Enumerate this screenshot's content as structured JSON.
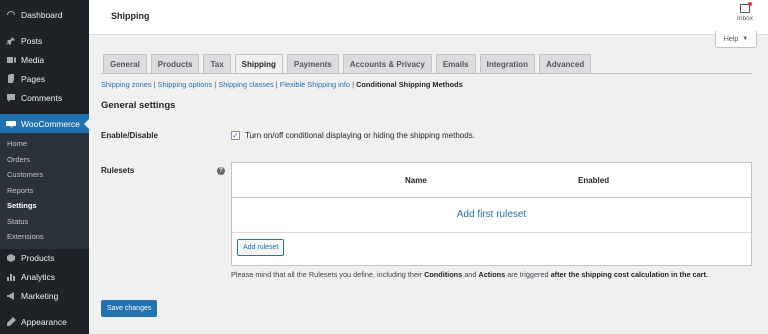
{
  "sidebar": {
    "top_items": [
      {
        "label": "Dashboard",
        "icon": "dashboard-icon"
      },
      {
        "label": "Posts",
        "icon": "pin-icon"
      },
      {
        "label": "Media",
        "icon": "media-icon"
      },
      {
        "label": "Pages",
        "icon": "pages-icon"
      },
      {
        "label": "Comments",
        "icon": "comments-icon"
      }
    ],
    "woocommerce": {
      "label": "WooCommerce",
      "icon": "woocommerce-icon"
    },
    "sub_items": [
      "Home",
      "Orders",
      "Customers",
      "Reports",
      "Settings",
      "Status",
      "Extensions"
    ],
    "current_sub": "Settings",
    "bottom_items": [
      {
        "label": "Products",
        "icon": "products-icon"
      },
      {
        "label": "Analytics",
        "icon": "analytics-icon"
      },
      {
        "label": "Marketing",
        "icon": "marketing-icon"
      },
      {
        "label": "Appearance",
        "icon": "appearance-icon"
      }
    ]
  },
  "header": {
    "title": "Shipping",
    "inbox_label": "Inbox",
    "help_label": "Help"
  },
  "tabs": [
    "General",
    "Products",
    "Tax",
    "Shipping",
    "Payments",
    "Accounts & Privacy",
    "Emails",
    "Integration",
    "Advanced"
  ],
  "active_tab": "Shipping",
  "subsections": {
    "links": [
      "Shipping zones",
      "Shipping options",
      "Shipping classes",
      "Flexible Shipping info"
    ],
    "current": "Conditional Shipping Methods",
    "separator": " | "
  },
  "section_title": "General settings",
  "enable": {
    "label": "Enable/Disable",
    "checkbox_text": "Turn on/off conditional displaying or hiding the shipping methods.",
    "checked": true
  },
  "rulesets": {
    "label": "Rulesets",
    "tip_icon": "question-icon",
    "columns": [
      "Name",
      "Enabled"
    ],
    "empty_link": "Add first ruleset",
    "add_button": "Add ruleset"
  },
  "note": {
    "prefix": "Please mind that all the Rulesets you define, including their ",
    "conditions": "Conditions",
    "and": " and ",
    "actions": "Actions",
    "middle": " are triggered ",
    "emph": "after the shipping cost calculation in the cart."
  },
  "save_button": "Save changes",
  "colors": {
    "accent": "#2271b1",
    "sidebar_bg": "#1d2327",
    "submenu_bg": "#2c3338"
  }
}
